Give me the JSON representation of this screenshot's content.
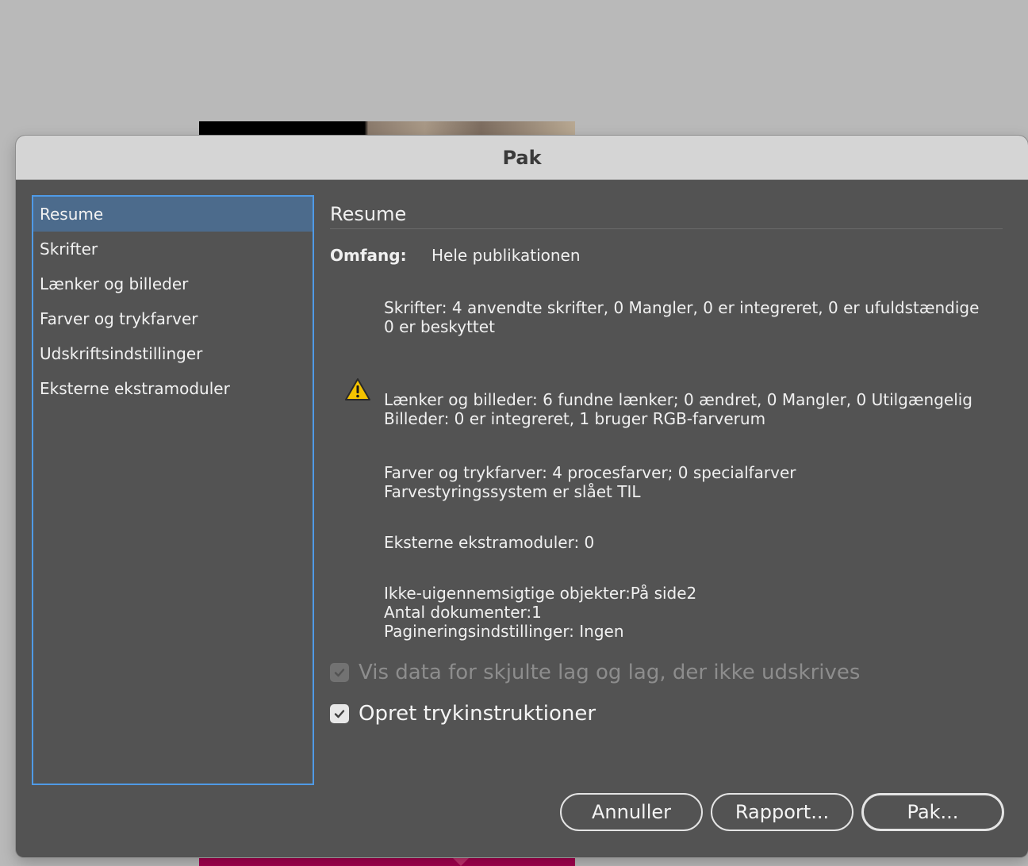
{
  "dialog": {
    "title": "Pak"
  },
  "sidebar": {
    "items": [
      {
        "label": "Resume",
        "selected": true
      },
      {
        "label": "Skrifter"
      },
      {
        "label": "Lænker og billeder"
      },
      {
        "label": "Farver og trykfarver"
      },
      {
        "label": "Udskriftsindstillinger"
      },
      {
        "label": "Eksterne ekstramoduler"
      }
    ]
  },
  "summary": {
    "title": "Resume",
    "scope_label": "Omfang:",
    "scope_value": "Hele publikationen",
    "fonts": [
      "Skrifter: 4 anvendte skrifter, 0 Mangler, 0 er integreret, 0 er ufuldstændige",
      "0 er beskyttet"
    ],
    "links": [
      "Lænker og billeder: 6 fundne lænker; 0 ændret, 0 Mangler, 0 Utilgængelig",
      "Billeder: 0 er integreret, 1 bruger RGB-farverum"
    ],
    "links_warning_icon": "warning-triangle-icon",
    "colors": [
      "Farver og trykfarver: 4 procesfarver; 0 specialfarver",
      "Farvestyringssystem er slået TIL"
    ],
    "plugins": [
      "Eksterne ekstramoduler: 0"
    ],
    "other": [
      "Ikke-uigennemsigtige objekter:På side2",
      "Antal dokumenter:1",
      "Pagineringsindstillinger: Ingen"
    ]
  },
  "options": {
    "hidden_layers": {
      "label": "Vis data for skjulte lag og lag, der ikke udskrives",
      "checked": true,
      "enabled": false
    },
    "instructions": {
      "label": "Opret trykinstruktioner",
      "checked": true,
      "enabled": true
    }
  },
  "buttons": {
    "cancel": "Annuller",
    "report": "Rapport...",
    "package": "Pak..."
  },
  "colors": {
    "dialog_bg": "#535353",
    "selection": "#4c6b8c",
    "focus_ring": "#4f9ae6",
    "warning": "#f5c400"
  }
}
